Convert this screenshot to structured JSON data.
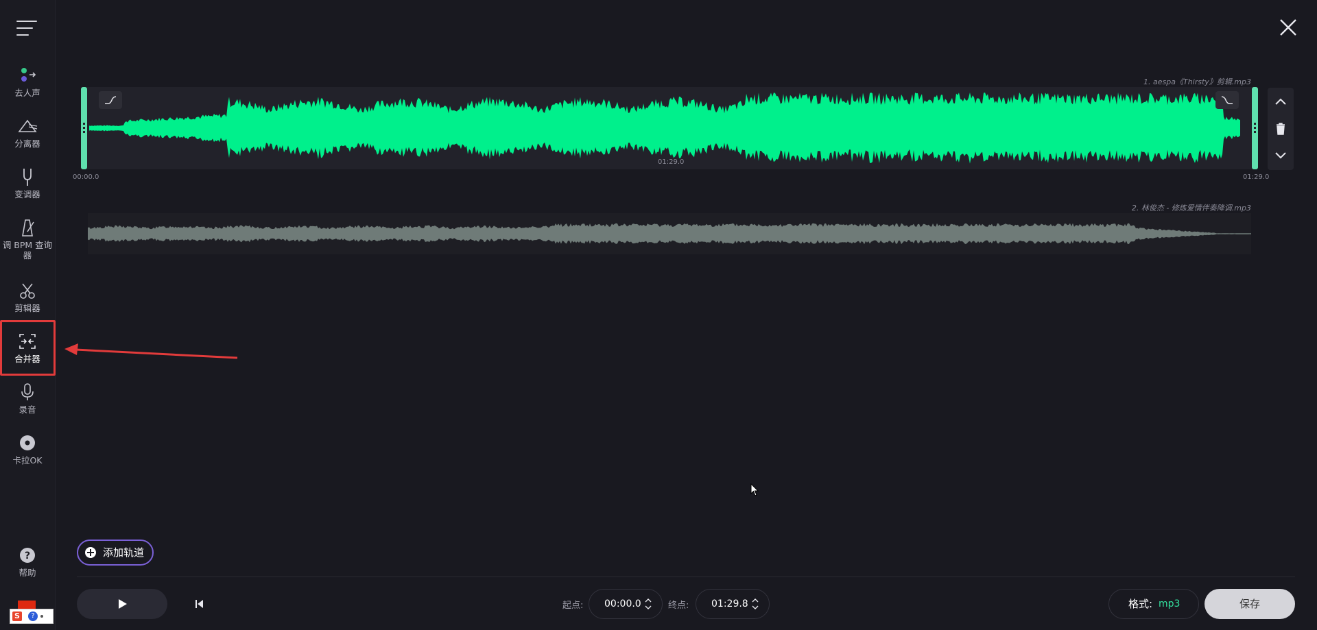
{
  "sidebar": {
    "items": [
      {
        "label": "去人声",
        "icon": "vocal-remover-icon"
      },
      {
        "label": "分离器",
        "icon": "splitter-icon"
      },
      {
        "label": "变调器",
        "icon": "tuning-fork-icon"
      },
      {
        "label": "调 BPM 查询器",
        "icon": "metronome-icon"
      },
      {
        "label": "剪辑器",
        "icon": "scissors-icon"
      },
      {
        "label": "合并器",
        "icon": "merge-icon",
        "active": true
      },
      {
        "label": "录音",
        "icon": "microphone-icon"
      },
      {
        "label": "卡拉OK",
        "icon": "disc-icon"
      }
    ],
    "help_label": "帮助"
  },
  "tracks": [
    {
      "name": "1. aespa《Thirsty》剪辑.mp3",
      "start_label": "00:00.0",
      "mid_label": "01:29.0",
      "end_label": "01:29.0",
      "waveform_color": "#00f08c"
    },
    {
      "name": "2. 林俊杰 - 修炼爱情伴奏降调.mp3",
      "waveform_color": "#6f7b78"
    }
  ],
  "add_track_label": "添加轨道",
  "bottom": {
    "start_label": "起点:",
    "start_value": "00:00.0",
    "end_label": "终点:",
    "end_value": "01:29.8",
    "format_label": "格式:",
    "format_value": "mp3",
    "save_label": "保存"
  },
  "colors": {
    "background": "#191920",
    "accent_green": "#34e3a0",
    "accent_purple": "#7a60d6",
    "annotation_red": "#e23b3b"
  }
}
